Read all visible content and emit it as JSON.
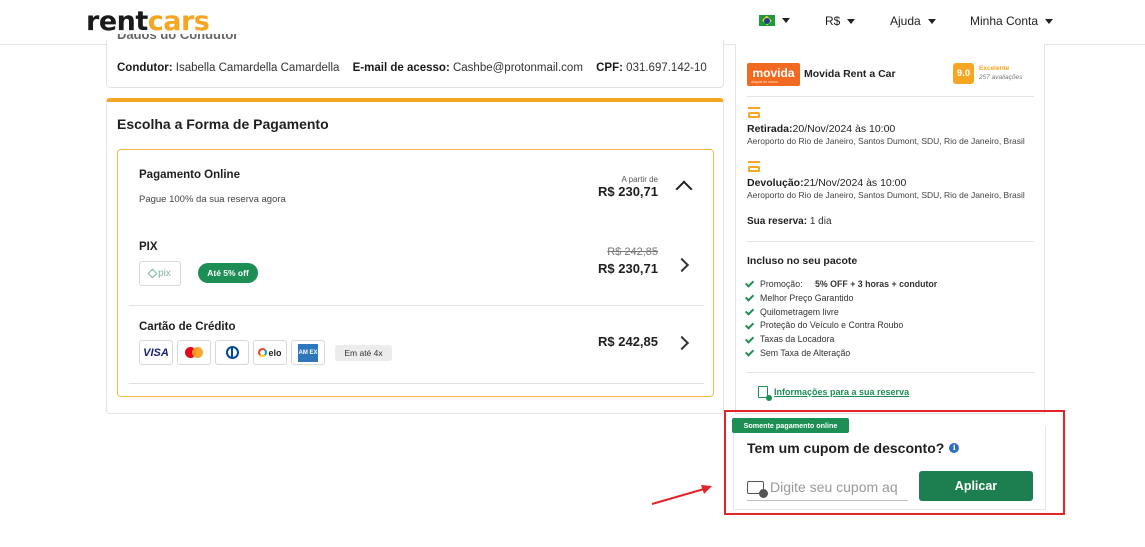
{
  "header": {
    "logo_part1": "rent",
    "logo_part2": "cars",
    "currency": "R$",
    "help": "Ajuda",
    "account": "Minha Conta"
  },
  "driver": {
    "section_title_cut": "Dados do Condutor",
    "driver_label": "Condutor:",
    "driver_value": "Isabella Camardella Camardella",
    "email_label": "E-mail de acesso:",
    "email_value": "Cashbe@protonmail.com",
    "cpf_label": "CPF:",
    "cpf_value": "031.697.142-10"
  },
  "payment": {
    "title": "Escolha a Forma de Pagamento",
    "online": {
      "title": "Pagamento Online",
      "subtitle": "Pague 100% da sua reserva agora",
      "from_label": "A partir de",
      "price": "R$ 230,71"
    },
    "pix": {
      "title": "PIX",
      "logo_text": "pix",
      "badge": "Até 5% off",
      "old_price": "R$ 242,85",
      "price": "R$ 230,71"
    },
    "credit": {
      "title": "Cartão de Crédito",
      "visa": "VISA",
      "elo": "elo",
      "amex": "AM EX",
      "installments": "Em até 4x",
      "price": "R$ 242,85"
    }
  },
  "sidebar": {
    "company_logo": "movida",
    "company_logo_tag": "aluguel de carros",
    "company_name": "Movida Rent a Car",
    "score": "9.0",
    "score_label": "Excelente",
    "reviews": "257 avaliações",
    "pickup_label": "Retirada:",
    "pickup_date": "20/Nov/2024 às 10:00",
    "pickup_address": "Aeroporto do Rio de Janeiro, Santos Dumont, SDU, Rio de Janeiro, Brasil",
    "return_label": "Devolução:",
    "return_date": "21/Nov/2024 às 10:00",
    "return_address": "Aeroporto do Rio de Janeiro, Santos Dumont, SDU, Rio de Janeiro, Brasil",
    "reservation_label": "Sua reserva:",
    "reservation_value": "1 dia",
    "included_title": "Incluso no seu pacote",
    "promo_label": "Promoção:",
    "promo_value": "5% OFF + 3 horas + condutor",
    "included_items": [
      "Melhor Preço Garantido",
      "Quilometragem livre",
      "Proteção do Veículo e Contra Roubo",
      "Taxas da Locadora",
      "Sem Taxa de Alteração"
    ],
    "info_link": "Informações para a sua reserva"
  },
  "coupon": {
    "badge": "Somente pagamento online",
    "title": "Tem um cupom de desconto?",
    "info_icon": "i",
    "placeholder": "Digite seu cupom aqui",
    "apply_label": "Aplicar"
  },
  "colors": {
    "brand_orange": "#f5a623",
    "brand_green": "#1d8f54",
    "highlight_red": "#e3242b"
  }
}
